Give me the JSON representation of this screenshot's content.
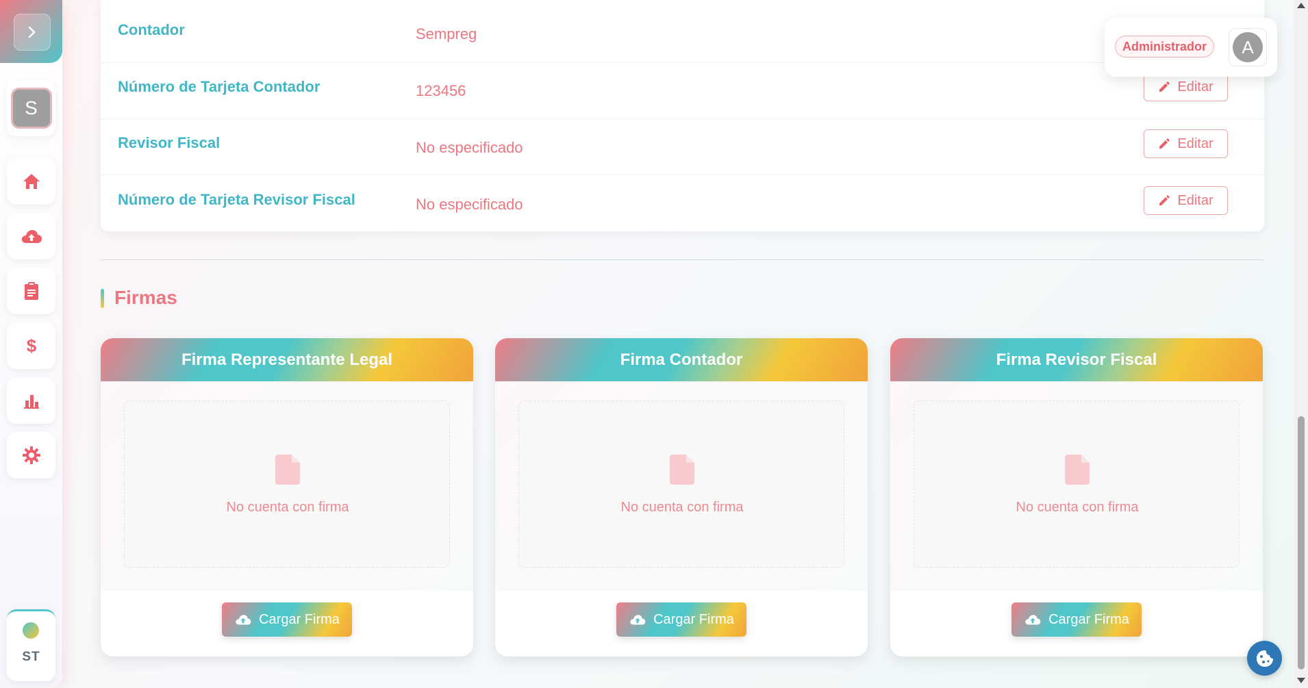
{
  "sidebar": {
    "user_initial": "S",
    "nav": [
      {
        "icon": "home-icon"
      },
      {
        "icon": "cloud-upload-icon"
      },
      {
        "icon": "clipboard-icon"
      },
      {
        "icon": "dollar-icon"
      },
      {
        "icon": "bar-chart-icon"
      },
      {
        "icon": "gear-icon"
      }
    ],
    "bottom_label": "ST"
  },
  "header": {
    "role_badge": "Administrador",
    "avatar_initial": "A"
  },
  "info": {
    "rows": [
      {
        "label": "Contador",
        "value": "Sempreg"
      },
      {
        "label": "Número de Tarjeta Contador",
        "value": "123456",
        "button": "Editar"
      },
      {
        "label": "Revisor Fiscal",
        "value": "No especificado",
        "button": "Editar"
      },
      {
        "label": "Número de Tarjeta Revisor Fiscal",
        "value": "No especificado",
        "button": "Editar"
      }
    ]
  },
  "firmas": {
    "title": "Firmas",
    "cards": [
      {
        "title": "Firma Representante Legal",
        "empty_text": "No cuenta con firma",
        "button": "Cargar Firma"
      },
      {
        "title": "Firma Contador",
        "empty_text": "No cuenta con firma",
        "button": "Cargar Firma"
      },
      {
        "title": "Firma Revisor Fiscal",
        "empty_text": "No cuenta con firma",
        "button": "Cargar Firma"
      }
    ]
  },
  "colors": {
    "accent_pink": "#ec7780",
    "accent_teal": "#41b6c7",
    "accent_yellow": "#f5c83a"
  }
}
